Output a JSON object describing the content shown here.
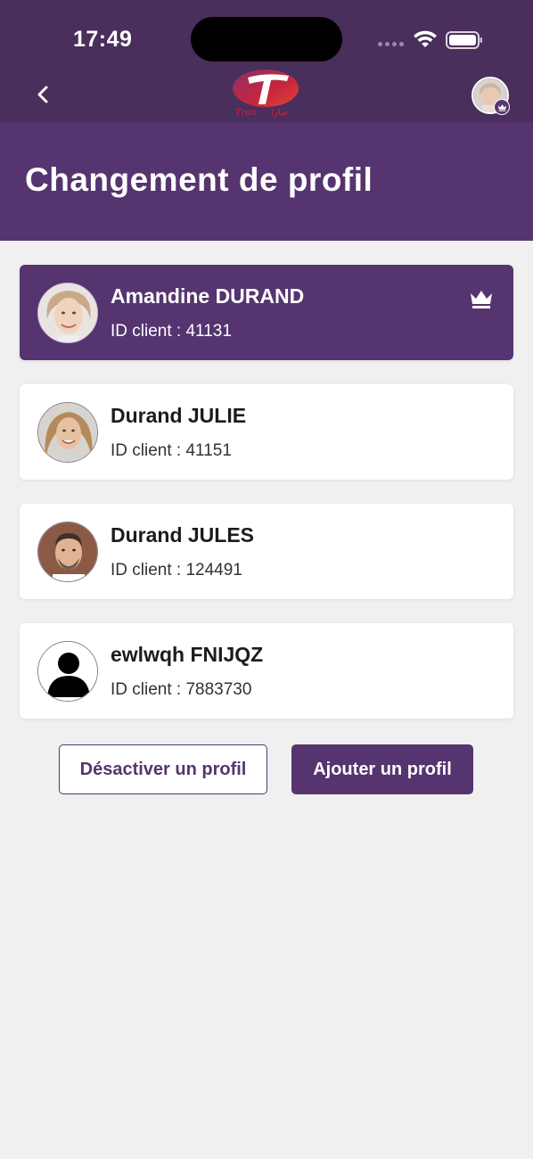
{
  "status_bar": {
    "time": "17:49"
  },
  "header": {
    "back_icon": "chevron-left-icon",
    "logo_text_left": "Tran",
    "logo_text_right": "سارا",
    "profile_badge_icon": "crown-icon"
  },
  "page": {
    "title": "Changement de profil"
  },
  "profiles": [
    {
      "name": "Amandine DURAND",
      "client_id": "ID client : 41131",
      "active": true,
      "avatar": "photo",
      "badge_icon": "crown-icon"
    },
    {
      "name": "Durand JULIE",
      "client_id": "ID client : 41151",
      "active": false,
      "avatar": "photo"
    },
    {
      "name": "Durand JULES",
      "client_id": "ID client : 124491",
      "active": false,
      "avatar": "photo"
    },
    {
      "name": "ewlwqh FNIJQZ",
      "client_id": "ID client : 7883730",
      "active": false,
      "avatar": "default-user-icon"
    }
  ],
  "actions": {
    "deactivate_label": "Désactiver un profil",
    "add_label": "Ajouter un profil"
  },
  "colors": {
    "topbar": "#4a2e5c",
    "primary": "#563470",
    "background": "#f1f0f1",
    "card": "#ffffff"
  }
}
